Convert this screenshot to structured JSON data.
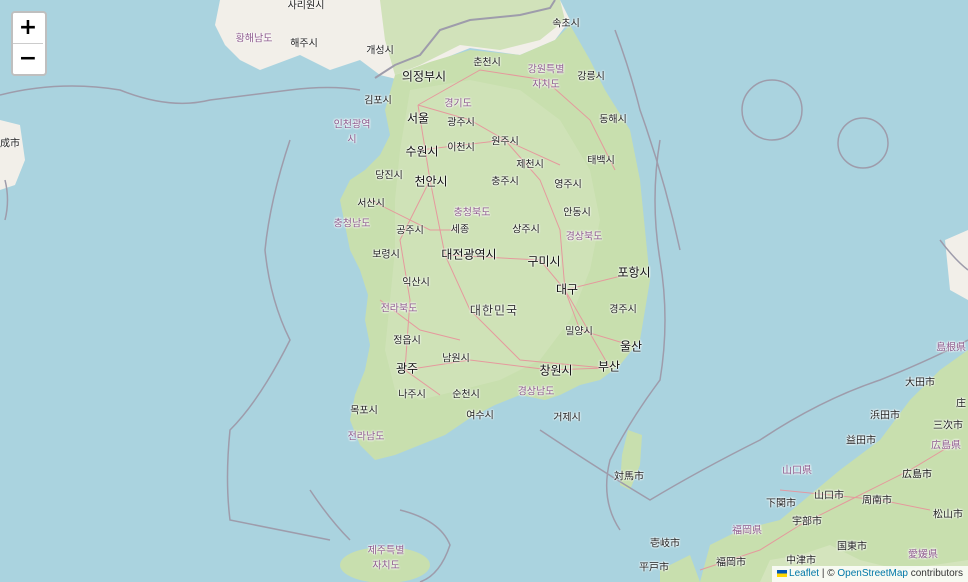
{
  "zoom": {
    "in_label": "+",
    "out_label": "−"
  },
  "attribution": {
    "leaflet": "Leaflet",
    "separator": " | © ",
    "osm": "OpenStreetMap",
    "suffix": " contributors"
  },
  "labels": {
    "sariwon": "사리원시",
    "hwanghaenamdo": "황해남도",
    "haeju": "해주시",
    "kaesong": "개성시",
    "sokcho": "속초시",
    "chuncheon": "춘천시",
    "uijeongbu": "의정부시",
    "gangwon1": "강원특별",
    "gangwon2": "자치도",
    "gangneung": "강릉시",
    "gimpo": "김포시",
    "gyeonggi": "경기도",
    "incheon1": "인천광역",
    "incheon2": "시",
    "seoul": "서울",
    "gwangju_g": "광주시",
    "wonju": "원주시",
    "donghae": "동해시",
    "suwon": "수원시",
    "icheon": "이천시",
    "jecheon": "제천시",
    "taebaek": "태백시",
    "dangjin": "당진시",
    "cheonan": "천안시",
    "chungju": "충주시",
    "yeongju": "영주시",
    "seosan": "서산시",
    "chungbuk": "충청북도",
    "andong": "안동시",
    "chungnam": "충청남도",
    "gongju": "공주시",
    "sejong": "세종",
    "sangju": "상주시",
    "gyeongbuk": "경상북도",
    "boryeong": "보령시",
    "daejeon": "대전광역시",
    "gumi": "구미시",
    "pohang": "포항시",
    "iksan": "익산시",
    "daegu": "대구",
    "jeonbuk": "전라북도",
    "korea": "대한민국",
    "gyeongju": "경주시",
    "miryang": "밀양시",
    "ulsan": "울산",
    "jeongeup": "정읍시",
    "namwon": "남원시",
    "gwangju": "광주",
    "changwon": "창원시",
    "busan": "부산",
    "naju": "나주시",
    "suncheon": "순천시",
    "gyeongnam": "경상남도",
    "mokpo": "목포시",
    "yeosu": "여수시",
    "geoje": "거제시",
    "jeonnam": "전라남도",
    "tsushima": "対馬市",
    "jeju1": "제주특별",
    "jeju2": "자치도",
    "iki": "壱岐市",
    "hirado": "平戸市",
    "fukuoka_ken": "福岡県",
    "fukuoka": "福岡市",
    "nakatsu": "中津市",
    "shimonoseki": "下関市",
    "ube": "宇部市",
    "yamaguchi_ken": "山口県",
    "yamaguchi": "山口市",
    "shunan": "周南市",
    "kunisaki": "国東市",
    "ehime": "愛媛県",
    "matsuyama": "松山市",
    "hiroshima": "広島市",
    "hiroshima_ken": "広島県",
    "masuda": "益田市",
    "hamada": "浜田市",
    "miyoshi": "三次市",
    "oda": "大田市",
    "shimane": "島根県",
    "shou": "庄",
    "chengshi": "成市"
  },
  "colors": {
    "water": "#aad3df",
    "land": "#f2efe9",
    "forest": "#c8dfae",
    "border": "#9e9cab",
    "road": "#e8929b"
  }
}
